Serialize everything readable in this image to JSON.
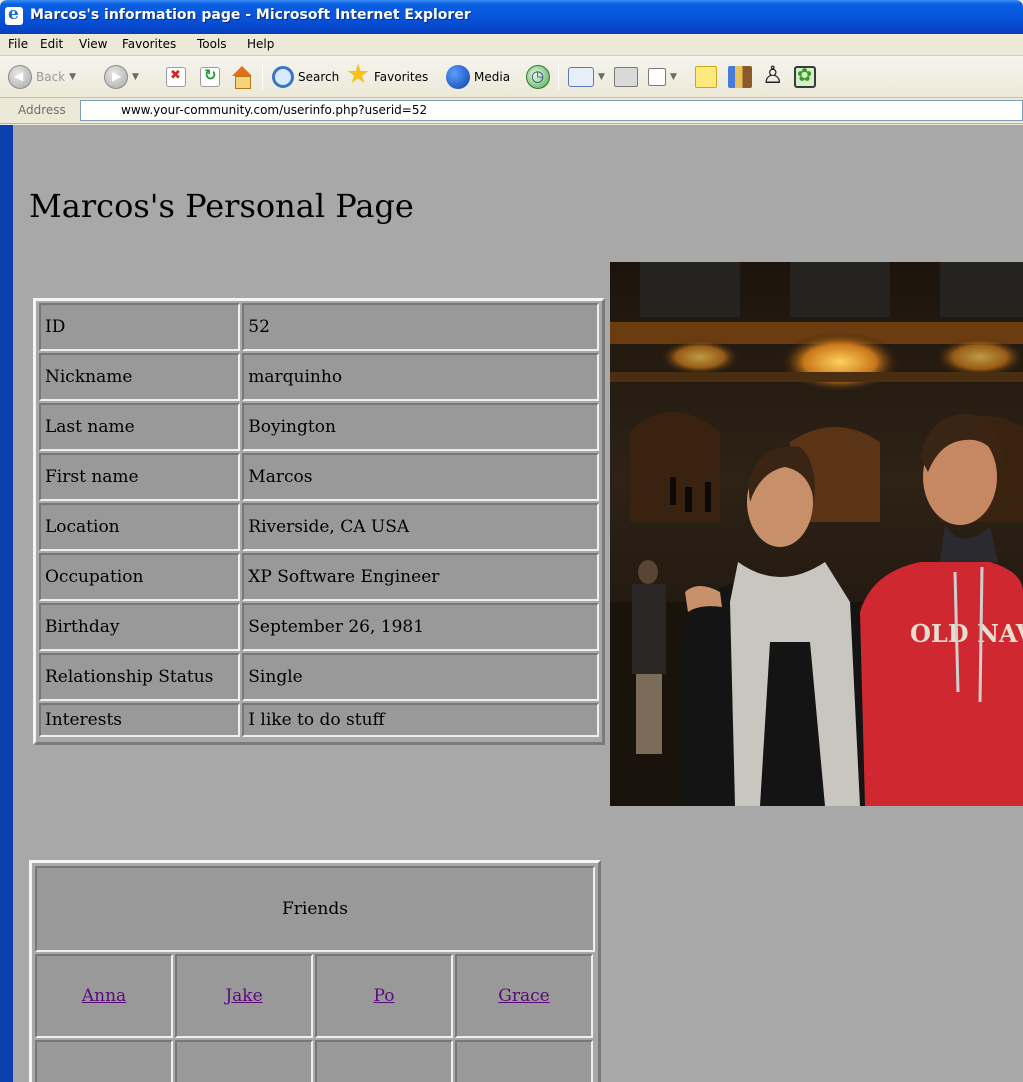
{
  "window": {
    "title": "Marcos's information page - Microsoft Internet Explorer"
  },
  "menubar": {
    "items": [
      "File",
      "Edit",
      "View",
      "Favorites",
      "Tools",
      "Help"
    ]
  },
  "toolbar": {
    "back_label": "Back",
    "search_label": "Search",
    "favorites_label": "Favorites",
    "media_label": "Media"
  },
  "address": {
    "label": "Address",
    "url": "www.your-community.com/userinfo.php?userid=52"
  },
  "page": {
    "title": "Marcos's Personal Page",
    "profile": [
      {
        "key": "ID",
        "value": "52"
      },
      {
        "key": "Nickname",
        "value": "marquinho"
      },
      {
        "key": "Last name",
        "value": "Boyington"
      },
      {
        "key": "First name",
        "value": "Marcos"
      },
      {
        "key": "Location",
        "value": "Riverside, CA USA"
      },
      {
        "key": "Occupation",
        "value": "XP Software Engineer"
      },
      {
        "key": "Birthday",
        "value": "September 26, 1981"
      },
      {
        "key": "Relationship Status",
        "value": "Single"
      },
      {
        "key": "Interests",
        "value": "I like to do stuff"
      }
    ],
    "photo": {
      "shirt_text": "OLD NAVY"
    },
    "friends": {
      "header": "Friends",
      "names": [
        "Anna",
        "Jake",
        "Po",
        "Grace"
      ],
      "link_color": "#5a0a7a"
    }
  },
  "colors": {
    "page_background": "#a8a8a8",
    "cell_background": "#999999",
    "titlebar_blue": "#0855dd"
  }
}
